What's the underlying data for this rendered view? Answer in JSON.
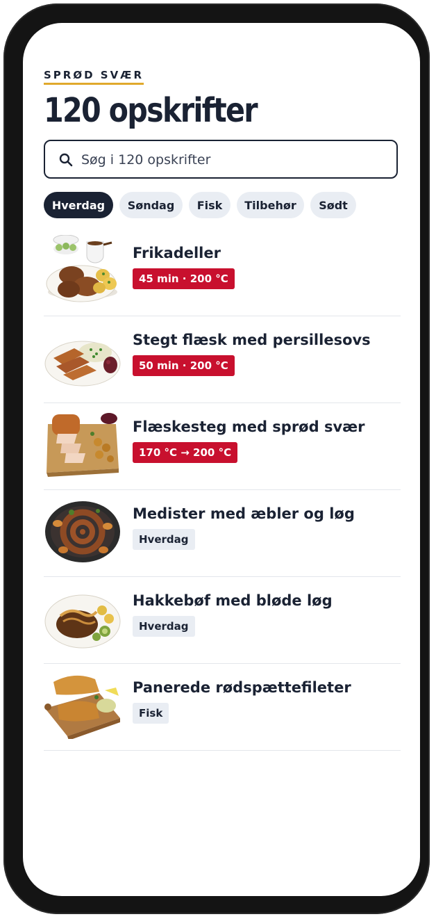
{
  "header": {
    "brand": "SPRØD SVÆR",
    "title": "120 opskrifter"
  },
  "search": {
    "placeholder": "Søg i 120 opskrifter",
    "value": ""
  },
  "chips": [
    {
      "label": "Hverdag",
      "active": true
    },
    {
      "label": "Søndag",
      "active": false
    },
    {
      "label": "Fisk",
      "active": false
    },
    {
      "label": "Tilbehør",
      "active": false
    },
    {
      "label": "Sødt",
      "active": false
    }
  ],
  "recipes": [
    {
      "title": "Frikadeller",
      "badge": "45 min · 200 °C",
      "badge_style": "red",
      "image_icon": "frikadeller-plate"
    },
    {
      "title": "Stegt flæsk med persillesovs",
      "badge": "50 min · 200 °C",
      "badge_style": "red",
      "image_icon": "pork-belly-plate"
    },
    {
      "title": "Flæskesteg med sprød svær",
      "badge": "170 °C → 200 °C",
      "badge_style": "red",
      "image_icon": "roast-pork-board"
    },
    {
      "title": "Medister med æbler og løg",
      "badge": "Hverdag",
      "badge_style": "gray",
      "image_icon": "sausage-spiral-plate"
    },
    {
      "title": "Hakkebøf med bløde løg",
      "badge": "Hverdag",
      "badge_style": "gray",
      "image_icon": "beef-patty-plate"
    },
    {
      "title": "Panerede rødspættefileter",
      "badge": "Fisk",
      "badge_style": "gray",
      "image_icon": "fish-fillet-board"
    }
  ],
  "colors": {
    "ink": "#1a2233",
    "accent": "#e0a92c",
    "badge_red": "#c8102e",
    "chip_bg": "#e9edf3"
  }
}
